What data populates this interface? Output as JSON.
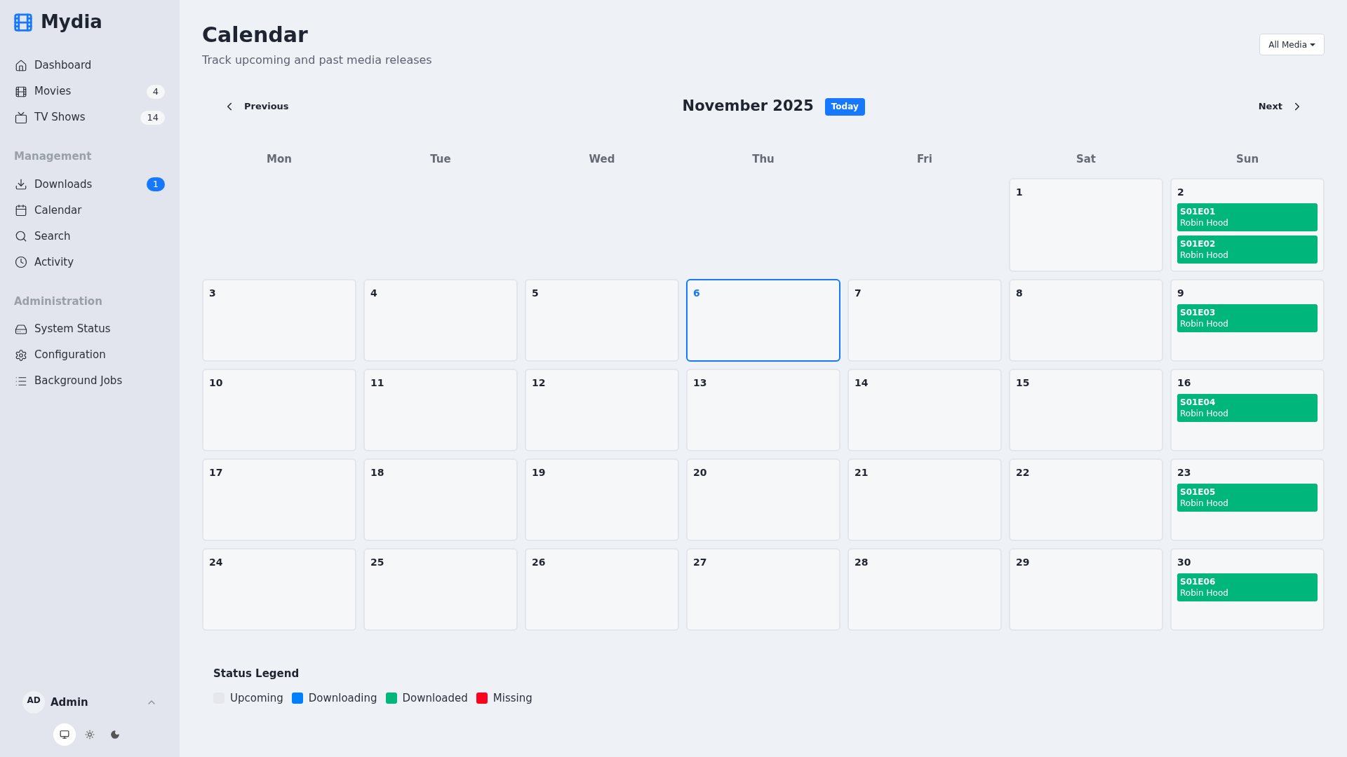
{
  "app": {
    "name": "Mydia"
  },
  "nav_sections": [
    {
      "items": [
        {
          "kind": "home",
          "label": "Dashboard"
        },
        {
          "kind": "film",
          "label": "Movies",
          "badge": {
            "text": "4",
            "kind": "neutral"
          }
        },
        {
          "kind": "tv",
          "label": "TV Shows",
          "badge": {
            "text": "14",
            "kind": "neutral"
          }
        }
      ]
    },
    {
      "heading": "Management",
      "items": [
        {
          "kind": "download",
          "label": "Downloads",
          "badge": {
            "text": "1",
            "kind": "primary"
          }
        },
        {
          "kind": "calendar",
          "label": "Calendar"
        },
        {
          "kind": "search",
          "label": "Search"
        },
        {
          "kind": "clock",
          "label": "Activity"
        }
      ]
    },
    {
      "heading": "Administration",
      "items": [
        {
          "kind": "drive",
          "label": "System Status"
        },
        {
          "kind": "gear",
          "label": "Configuration"
        },
        {
          "kind": "list",
          "label": "Background Jobs"
        }
      ]
    }
  ],
  "user": {
    "initials": "AD",
    "name": "Admin"
  },
  "theme_buttons": [
    {
      "kind": "system",
      "selected": true
    },
    {
      "kind": "light",
      "selected": false
    },
    {
      "kind": "dark",
      "selected": false
    }
  ],
  "page": {
    "title": "Calendar",
    "subtitle": "Track upcoming and past media releases",
    "filter": "All Media"
  },
  "nav": {
    "previous": "Previous",
    "month": "November 2025",
    "today": "Today",
    "next": "Next"
  },
  "weekdays": [
    "Mon",
    "Tue",
    "Wed",
    "Thu",
    "Fri",
    "Sat",
    "Sun"
  ],
  "weeks": [
    [
      {
        "kind": "blank"
      },
      {
        "kind": "blank"
      },
      {
        "kind": "blank"
      },
      {
        "kind": "blank"
      },
      {
        "kind": "blank"
      },
      {
        "kind": "day",
        "day": "1",
        "today": false
      },
      {
        "kind": "day",
        "day": "2",
        "today": false,
        "events": [
          {
            "code": "S01E01",
            "title": "Robin Hood",
            "color": "#00b67a"
          },
          {
            "code": "S01E02",
            "title": "Robin Hood",
            "color": "#00b67a"
          }
        ]
      }
    ],
    [
      {
        "kind": "day",
        "day": "3",
        "today": false
      },
      {
        "kind": "day",
        "day": "4",
        "today": false
      },
      {
        "kind": "day",
        "day": "5",
        "today": false
      },
      {
        "kind": "day",
        "day": "6",
        "today": true
      },
      {
        "kind": "day",
        "day": "7",
        "today": false
      },
      {
        "kind": "day",
        "day": "8",
        "today": false
      },
      {
        "kind": "day",
        "day": "9",
        "today": false,
        "events": [
          {
            "code": "S01E03",
            "title": "Robin Hood",
            "color": "#00b67a"
          }
        ]
      }
    ],
    [
      {
        "kind": "day",
        "day": "10",
        "today": false
      },
      {
        "kind": "day",
        "day": "11",
        "today": false
      },
      {
        "kind": "day",
        "day": "12",
        "today": false
      },
      {
        "kind": "day",
        "day": "13",
        "today": false
      },
      {
        "kind": "day",
        "day": "14",
        "today": false
      },
      {
        "kind": "day",
        "day": "15",
        "today": false
      },
      {
        "kind": "day",
        "day": "16",
        "today": false,
        "events": [
          {
            "code": "S01E04",
            "title": "Robin Hood",
            "color": "#00b67a"
          }
        ]
      }
    ],
    [
      {
        "kind": "day",
        "day": "17",
        "today": false
      },
      {
        "kind": "day",
        "day": "18",
        "today": false
      },
      {
        "kind": "day",
        "day": "19",
        "today": false
      },
      {
        "kind": "day",
        "day": "20",
        "today": false
      },
      {
        "kind": "day",
        "day": "21",
        "today": false
      },
      {
        "kind": "day",
        "day": "22",
        "today": false
      },
      {
        "kind": "day",
        "day": "23",
        "today": false,
        "events": [
          {
            "code": "S01E05",
            "title": "Robin Hood",
            "color": "#00b67a"
          }
        ]
      }
    ],
    [
      {
        "kind": "day",
        "day": "24",
        "today": false
      },
      {
        "kind": "day",
        "day": "25",
        "today": false
      },
      {
        "kind": "day",
        "day": "26",
        "today": false
      },
      {
        "kind": "day",
        "day": "27",
        "today": false
      },
      {
        "kind": "day",
        "day": "28",
        "today": false
      },
      {
        "kind": "day",
        "day": "29",
        "today": false
      },
      {
        "kind": "day",
        "day": "30",
        "today": false,
        "events": [
          {
            "code": "S01E06",
            "title": "Robin Hood",
            "color": "#00b67a"
          }
        ]
      }
    ]
  ],
  "legend": {
    "title": "Status Legend",
    "items": [
      {
        "label": "Upcoming",
        "color": "#e5e7eb"
      },
      {
        "label": "Downloading",
        "color": "#0080ff"
      },
      {
        "label": "Downloaded",
        "color": "#00b67a"
      },
      {
        "label": "Missing",
        "color": "#ff0020"
      }
    ]
  }
}
